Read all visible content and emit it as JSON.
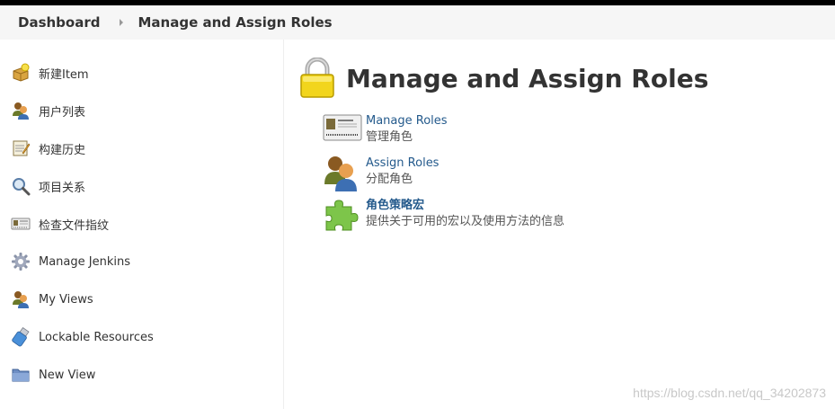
{
  "breadcrumb": {
    "items": [
      "Dashboard",
      "Manage and Assign Roles"
    ]
  },
  "sidebar": {
    "items": [
      {
        "label": "新建Item",
        "icon": "new-item-icon"
      },
      {
        "label": "用户列表",
        "icon": "users-icon"
      },
      {
        "label": "构建历史",
        "icon": "notepad-icon"
      },
      {
        "label": "项目关系",
        "icon": "search-icon"
      },
      {
        "label": "检查文件指纹",
        "icon": "fingerprint-icon"
      },
      {
        "label": "Manage Jenkins",
        "icon": "gear-icon"
      },
      {
        "label": "My Views",
        "icon": "users-icon"
      },
      {
        "label": "Lockable Resources",
        "icon": "usb-drive-icon"
      },
      {
        "label": "New View",
        "icon": "folder-icon"
      }
    ]
  },
  "main": {
    "title": "Manage and Assign Roles",
    "items": [
      {
        "link": "Manage Roles",
        "description": "管理角色",
        "icon": "id-card-icon"
      },
      {
        "link": "Assign Roles",
        "description": "分配角色",
        "icon": "users-icon"
      },
      {
        "link": "角色策略宏",
        "description": "提供关于可用的宏以及使用方法的信息",
        "icon": "puzzle-icon"
      }
    ]
  },
  "watermark": "https://blog.csdn.net/qq_34202873",
  "colors": {
    "link": "#245a8c",
    "breadcrumb_bg": "#f6f6f6",
    "lock_yellow": "#f2d51d",
    "puzzle_green": "#7dc54a"
  }
}
